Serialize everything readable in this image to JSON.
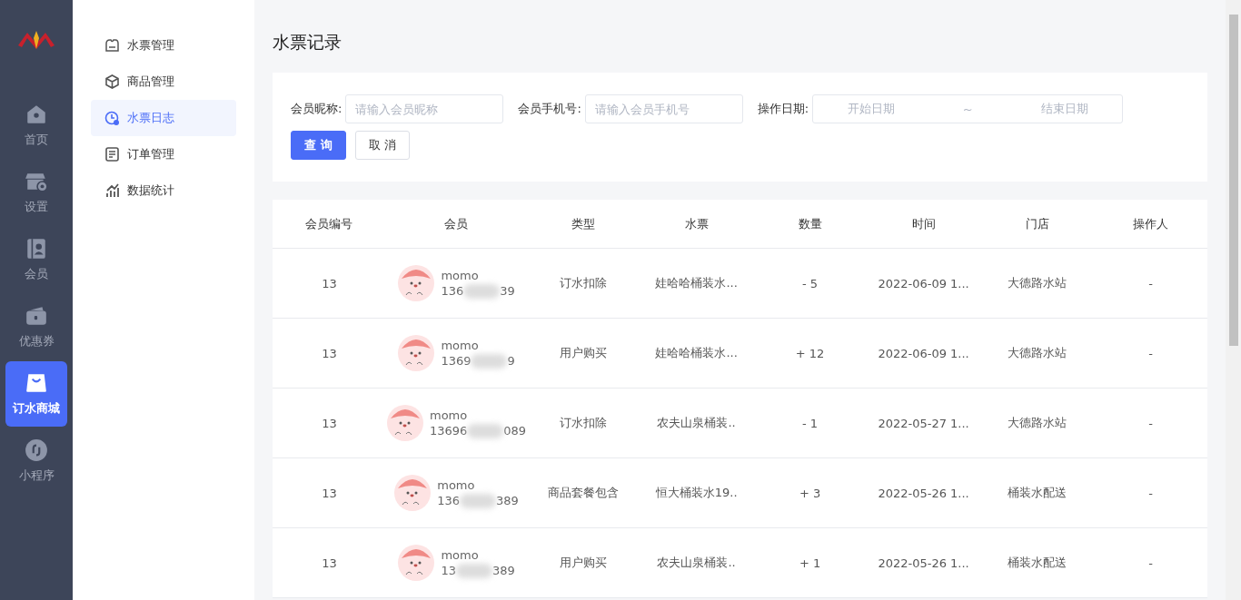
{
  "nav": [
    {
      "label": "首页",
      "selected": false
    },
    {
      "label": "设置",
      "selected": false
    },
    {
      "label": "会员",
      "selected": false
    },
    {
      "label": "优惠券",
      "selected": false
    },
    {
      "label": "订水商城",
      "selected": true
    },
    {
      "label": "小程序",
      "selected": false
    }
  ],
  "submenu": [
    {
      "label": "水票管理",
      "selected": false
    },
    {
      "label": "商品管理",
      "selected": false
    },
    {
      "label": "水票日志",
      "selected": true
    },
    {
      "label": "订单管理",
      "selected": false
    },
    {
      "label": "数据统计",
      "selected": false
    }
  ],
  "page_title": "水票记录",
  "filters": {
    "nickname_label": "会员昵称:",
    "nickname_placeholder": "请输入会员昵称",
    "phone_label": "会员手机号:",
    "phone_placeholder": "请输入会员手机号",
    "date_label": "操作日期:",
    "start_placeholder": "开始日期",
    "separator": "~",
    "end_placeholder": "结束日期",
    "query_button": "查 询",
    "cancel_button": "取 消"
  },
  "table": {
    "columns": [
      "会员编号",
      "会员",
      "类型",
      "水票",
      "数量",
      "时间",
      "门店",
      "操作人"
    ],
    "rows": [
      {
        "id": "13",
        "name": "momo",
        "phone_start": "136",
        "phone_end": "39",
        "type": "订水扣除",
        "ticket": "娃哈哈桶装水...",
        "qty": "- 5",
        "time": "2022-06-09 1...",
        "store": "大德路水站",
        "operator": "-"
      },
      {
        "id": "13",
        "name": "momo",
        "phone_start": "1369",
        "phone_end": "9",
        "type": "用户购买",
        "ticket": "娃哈哈桶装水...",
        "qty": "+ 12",
        "time": "2022-06-09 1...",
        "store": "大德路水站",
        "operator": "-"
      },
      {
        "id": "13",
        "name": "momo",
        "phone_start": "13696",
        "phone_end": "089",
        "type": "订水扣除",
        "ticket": "农夫山泉桶装..",
        "qty": "- 1",
        "time": "2022-05-27 1...",
        "store": "大德路水站",
        "operator": "-"
      },
      {
        "id": "13",
        "name": "momo",
        "phone_start": "136",
        "phone_end": "389",
        "type": "商品套餐包含",
        "ticket": "恒大桶装水19..",
        "qty": "+ 3",
        "time": "2022-05-26 1...",
        "store": "桶装水配送",
        "operator": "-"
      },
      {
        "id": "13",
        "name": "momo",
        "phone_start": "13",
        "phone_end": "389",
        "type": "用户购买",
        "ticket": "农夫山泉桶装..",
        "qty": "+ 1",
        "time": "2022-05-26 1...",
        "store": "桶装水配送",
        "operator": "-"
      }
    ]
  }
}
